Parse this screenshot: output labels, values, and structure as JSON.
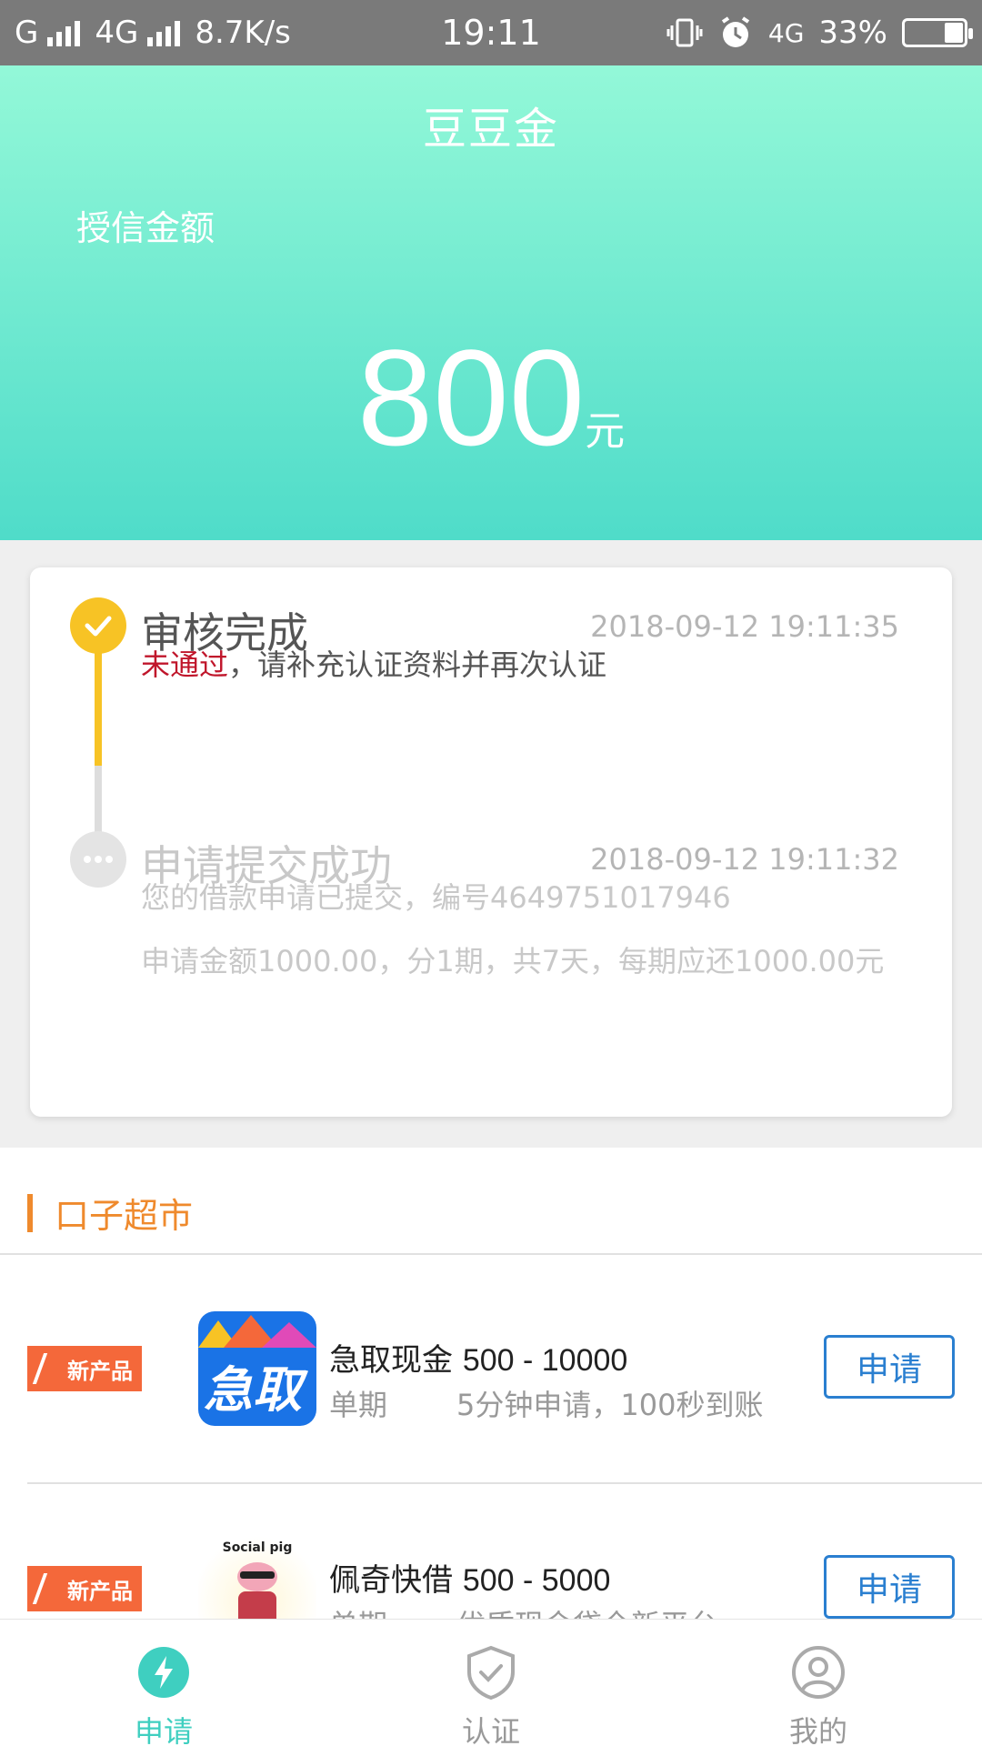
{
  "status_bar": {
    "carrier1": "G",
    "carrier2": "4G",
    "speed": "8.7K/s",
    "time": "19:11",
    "network": "4G",
    "battery": "33%",
    "battery_level": 0.33
  },
  "header": {
    "title": "豆豆金",
    "credit_label": "授信金额",
    "credit_amount": "800",
    "credit_unit": "元"
  },
  "progress": {
    "steps": [
      {
        "title": "审核完成",
        "time": "2018-09-12 19:11:35",
        "status": "未通过",
        "desc": "，请补充认证资料并再次认证"
      },
      {
        "title": "申请提交成功",
        "time": "2018-09-12 19:11:32",
        "line1": "您的借款申请已提交，编号4649751017946",
        "line2": "申请金额1000.00，分1期，共7天，每期应还1000.00元"
      }
    ]
  },
  "market": {
    "title": "口子超市",
    "products": [
      {
        "tag": "新产品",
        "logo_text": "急取",
        "name": "急取现金",
        "range": "500 - 10000",
        "term": "单期",
        "slogan": "5分钟申请，100秒到账",
        "apply_label": "申请"
      },
      {
        "tag": "新产品",
        "logo_text": "Social pig",
        "name": "佩奇快借",
        "range": "500 - 5000",
        "term": "单期",
        "slogan": "优质现金贷全新平台",
        "apply_label": "申请"
      }
    ]
  },
  "nav": {
    "items": [
      {
        "label": "申请",
        "icon": "lightning-icon",
        "active": true
      },
      {
        "label": "认证",
        "icon": "shield-check-icon",
        "active": false
      },
      {
        "label": "我的",
        "icon": "user-icon",
        "active": false
      }
    ]
  },
  "colors": {
    "accent": "#3fcfc0",
    "header_top": "#93f8d8",
    "header_bottom": "#4fdcc9",
    "step_done": "#f7c325",
    "fail_text": "#c0162b",
    "market_accent": "#ef8a2d",
    "button_blue": "#2a7fd0"
  }
}
